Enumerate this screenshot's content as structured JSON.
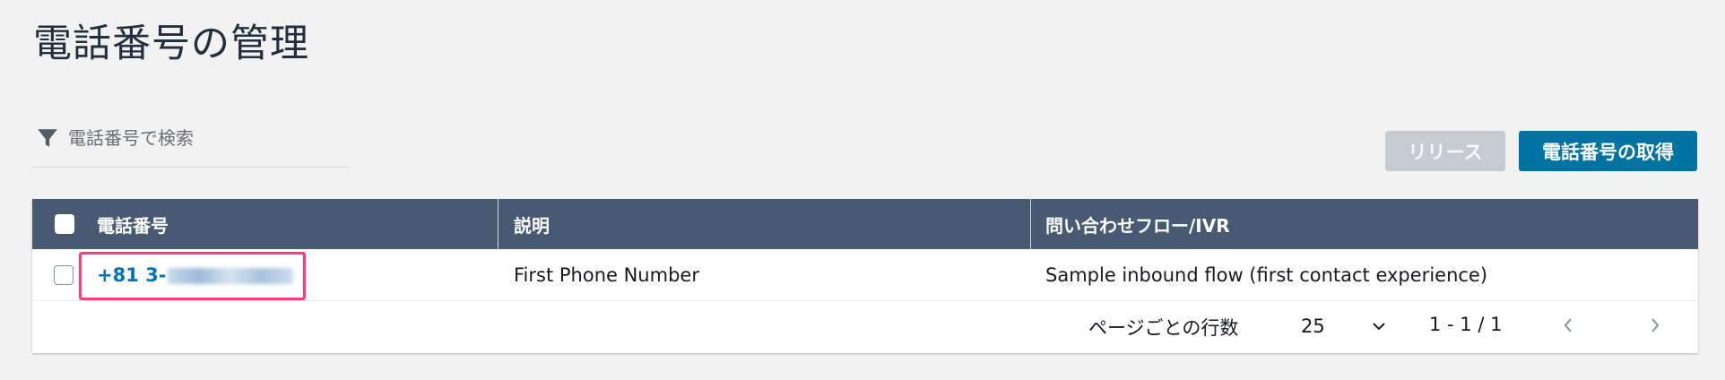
{
  "page": {
    "title": "電話番号の管理"
  },
  "search": {
    "placeholder": "電話番号で検索",
    "icon": "filter-icon"
  },
  "toolbar": {
    "release_label": "リリース",
    "get_number_label": "電話番号の取得",
    "colors": {
      "primary": "#0073a3",
      "disabled": "#c6cbd1",
      "header": "#475a72",
      "highlight": "#ff3c7f"
    }
  },
  "table": {
    "columns": [
      "電話番号",
      "説明",
      "問い合わせフロー/IVR"
    ],
    "rows": [
      {
        "phone": "+81 3-",
        "description": "First Phone Number",
        "flow": "Sample inbound flow (first contact experience)"
      }
    ]
  },
  "pagination": {
    "rows_per_page_label": "ページごとの行数",
    "rows_per_page": "25",
    "range": "1 - 1 / 1"
  }
}
